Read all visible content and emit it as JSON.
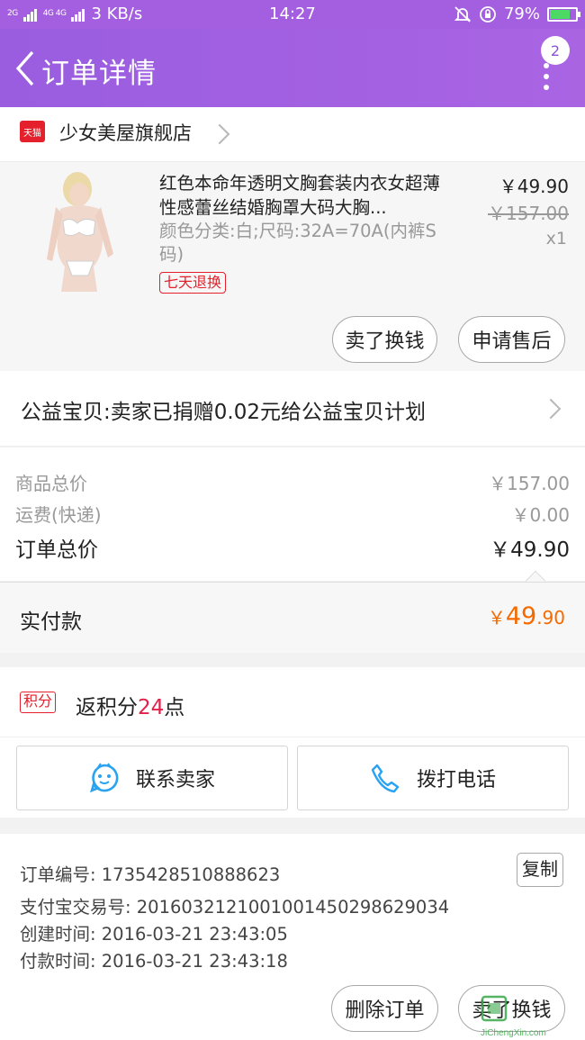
{
  "status_bar": {
    "signal_label_1": "2G",
    "signal_label_2": "4G 4G",
    "net_speed": "3 KB/s",
    "time": "14:27",
    "battery": "79%",
    "battery_level": 0.79
  },
  "header": {
    "title": "订单详情",
    "badge_count": "2"
  },
  "shop": {
    "tag": "天猫",
    "name": "少女美屋旗舰店"
  },
  "product": {
    "title": "红色本命年透明文胸套装内衣女超薄性感蕾丝结婚胸罩大码大胸...",
    "spec": "颜色分类:白;尺码:32A=70A(内裤S码)",
    "return_tag": "七天退换",
    "price": "￥49.90",
    "original_price": "￥157.00",
    "quantity": "x1",
    "btn_resell": "卖了换钱",
    "btn_after_sale": "申请售后"
  },
  "charity": {
    "text": "公益宝贝:卖家已捐赠0.02元给公益宝贝计划"
  },
  "totals": {
    "goods_label": "商品总价",
    "goods_value": "￥157.00",
    "shipping_label": "运费(快递)",
    "shipping_value": "￥0.00",
    "order_label": "订单总价",
    "order_value": "￥49.90"
  },
  "paid": {
    "label": "实付款",
    "currency": "￥",
    "integer": "49",
    "decimal": ".90"
  },
  "points": {
    "badge": "积分",
    "prefix": "返积分",
    "value": "24",
    "suffix": "点"
  },
  "contact": {
    "seller": "联系卖家",
    "phone": "拨打电话"
  },
  "order_info": {
    "order_no": "订单编号: 1735428510888623",
    "copy": "复制",
    "alipay_no": "支付宝交易号: 2016032121001001450298629034",
    "created": "创建时间: 2016-03-21 23:43:05",
    "paid": "付款时间: 2016-03-21 23:43:18"
  },
  "bottom": {
    "delete": "删除订单",
    "resell": "卖了换钱"
  },
  "watermark": {
    "text": "JiChengXin.com"
  }
}
